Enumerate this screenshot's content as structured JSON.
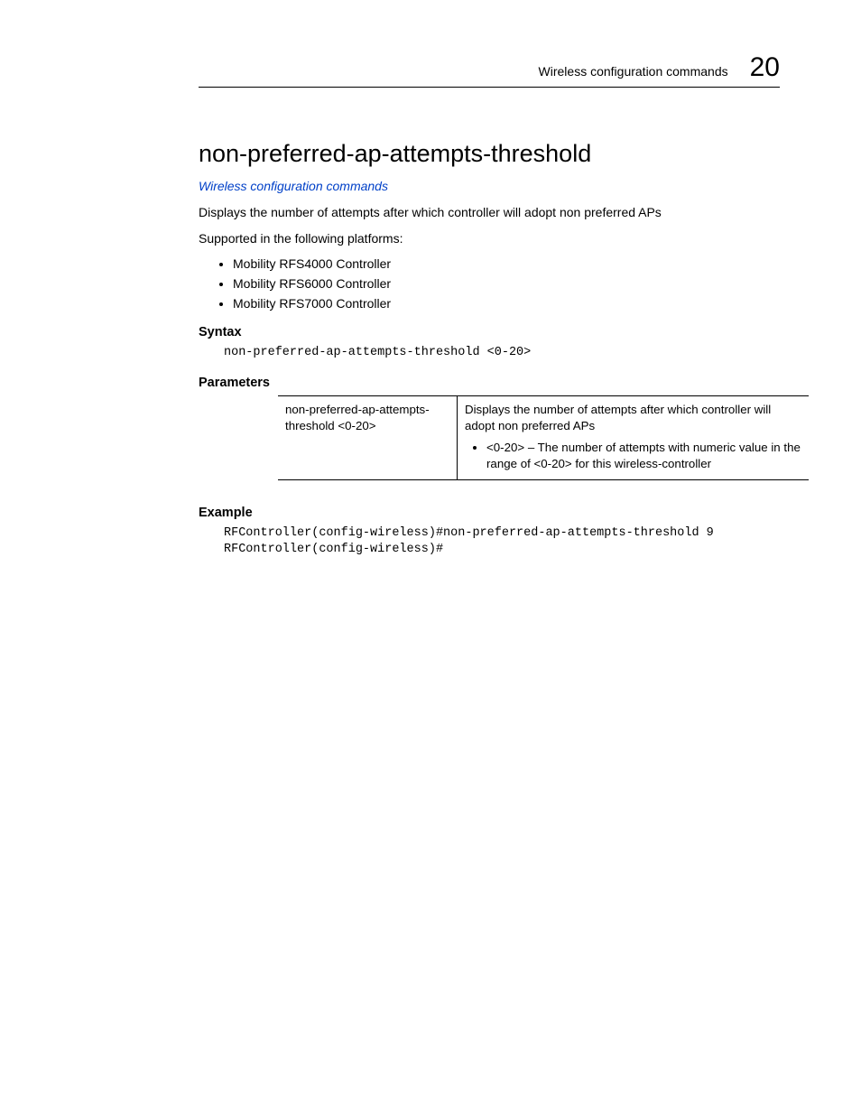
{
  "header": {
    "section_title": "Wireless configuration commands",
    "chapter_number": "20"
  },
  "command": {
    "title": "non-preferred-ap-attempts-threshold",
    "breadcrumb": "Wireless configuration commands",
    "description": "Displays the number of attempts after which controller will adopt non preferred APs",
    "supported_label": "Supported in the following platforms:",
    "platforms": [
      "Mobility RFS4000 Controller",
      "Mobility RFS6000 Controller",
      "Mobility RFS7000 Controller"
    ],
    "syntax_label": "Syntax",
    "syntax_code": "non-preferred-ap-attempts-threshold <0-20>",
    "parameters_label": "Parameters",
    "param_name": "non-preferred-ap-attempts-threshold <0-20>",
    "param_desc_main": "Displays the number of attempts after which controller will adopt non preferred APs",
    "param_desc_bullet": "<0-20> – The number of attempts with numeric value in the range of <0-20> for this wireless-controller",
    "example_label": "Example",
    "example_code": "RFController(config-wireless)#non-preferred-ap-attempts-threshold 9\nRFController(config-wireless)#"
  }
}
